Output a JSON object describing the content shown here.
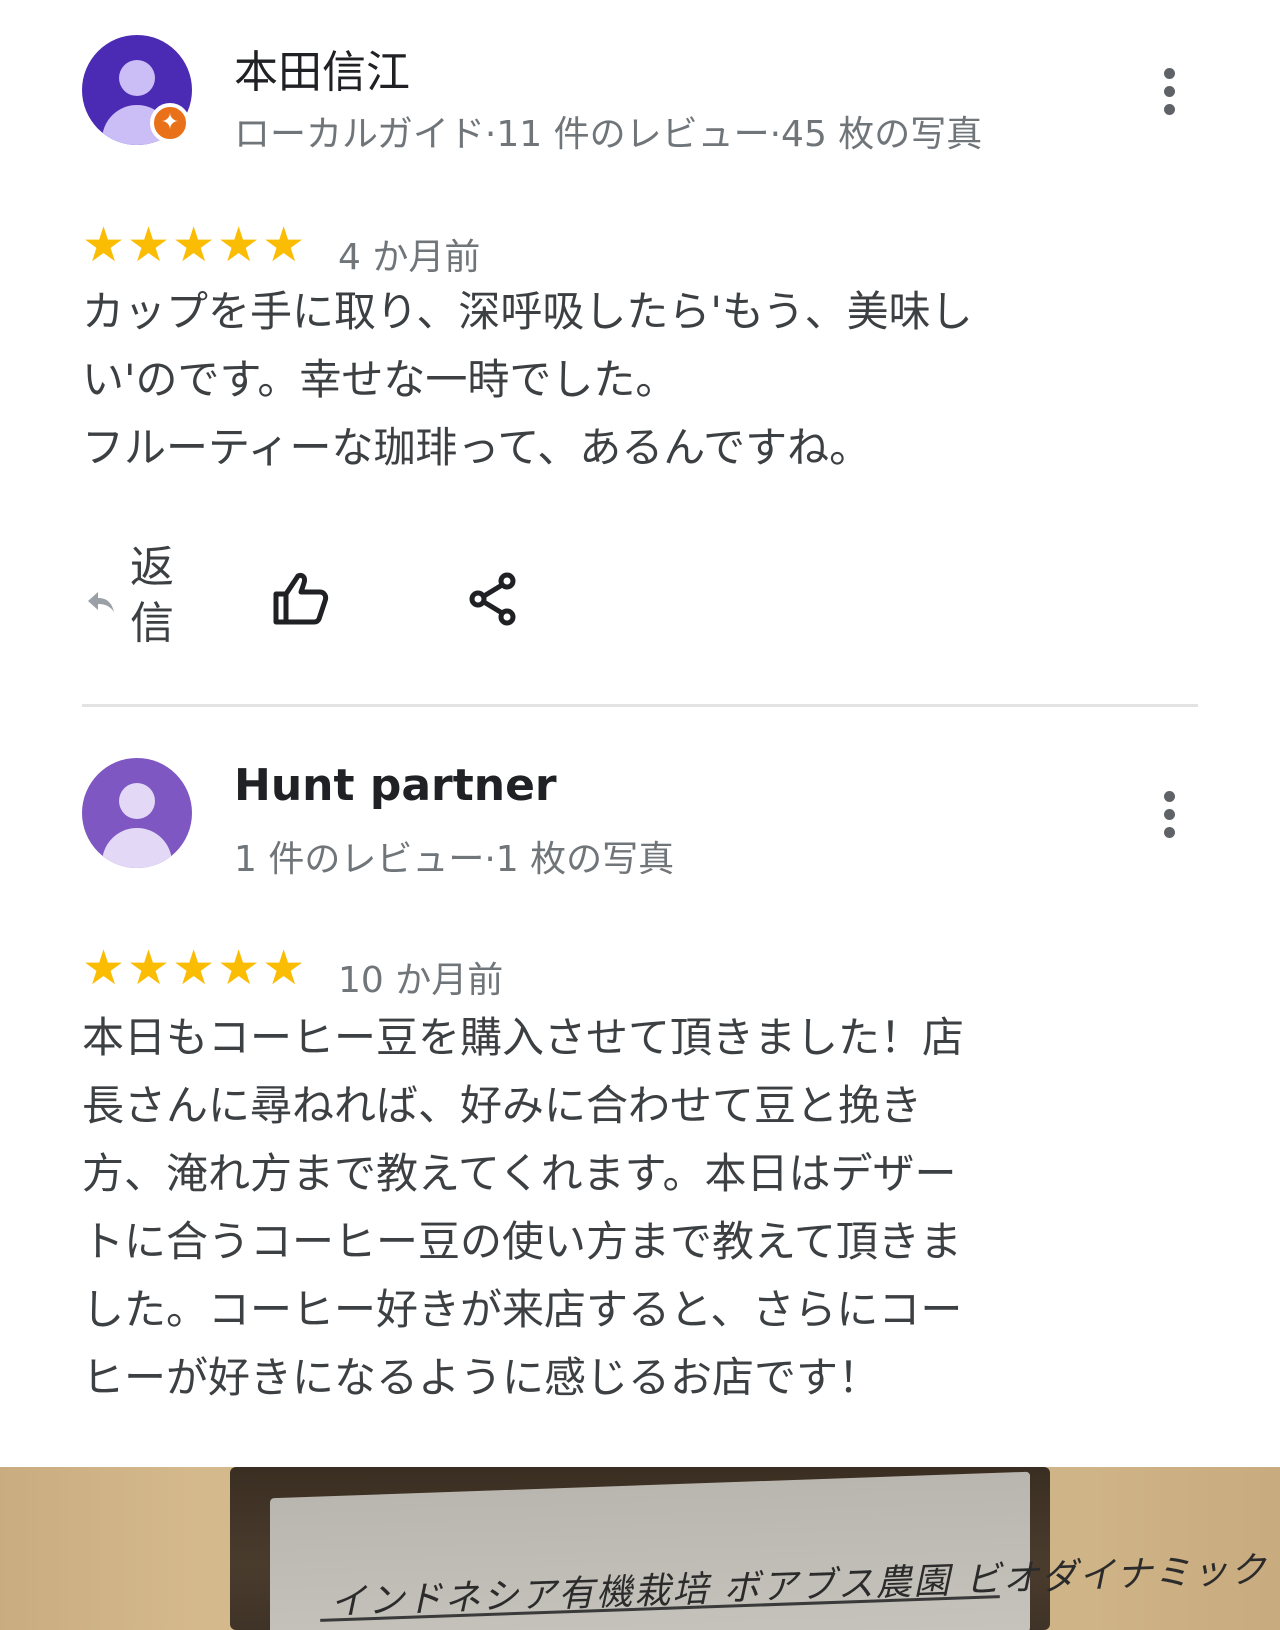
{
  "reviews": [
    {
      "name": "本田信江",
      "meta": "ローカルガイド·11 件のレビュー·45 枚の写真",
      "stars": "★★★★★",
      "date": "4 か月前",
      "text": "カップを手に取り、深呼吸したら'もう、美味し\nい'のです。幸せな一時でした。\nフルーティーな珈琲って、あるんですね。",
      "avatar_color": "#4b2bb3",
      "local_guide": true
    },
    {
      "name": "Hunt partner",
      "meta": "1 件のレビュー·1 枚の写真",
      "stars": "★★★★★",
      "date": "10 か月前",
      "text": "本日もコーヒー豆を購入させて頂きました！店\n長さんに尋ねれば、好みに合わせて豆と挽き\n方、淹れ方まで教えてくれます。本日はデザー\nトに合うコーヒー豆の使い方まで教えて頂きま\nした。コーヒー好きが来店すると、さらにコー\nヒーが好きになるように感じるお店です！",
      "avatar_color": "#7e57c2",
      "local_guide": false
    }
  ],
  "actions": {
    "reply_label": "返信",
    "reply_icon": "reply-arrow-icon",
    "like_icon": "thumbs-up-icon",
    "share_icon": "share-icon"
  },
  "photo": {
    "label_text": "インドネシア有機栽培 ボアブス農園 ビオダイナミック"
  },
  "colors": {
    "star": "#fbbc04",
    "meta_text": "#70757a",
    "guide_badge": "#e8711a"
  }
}
